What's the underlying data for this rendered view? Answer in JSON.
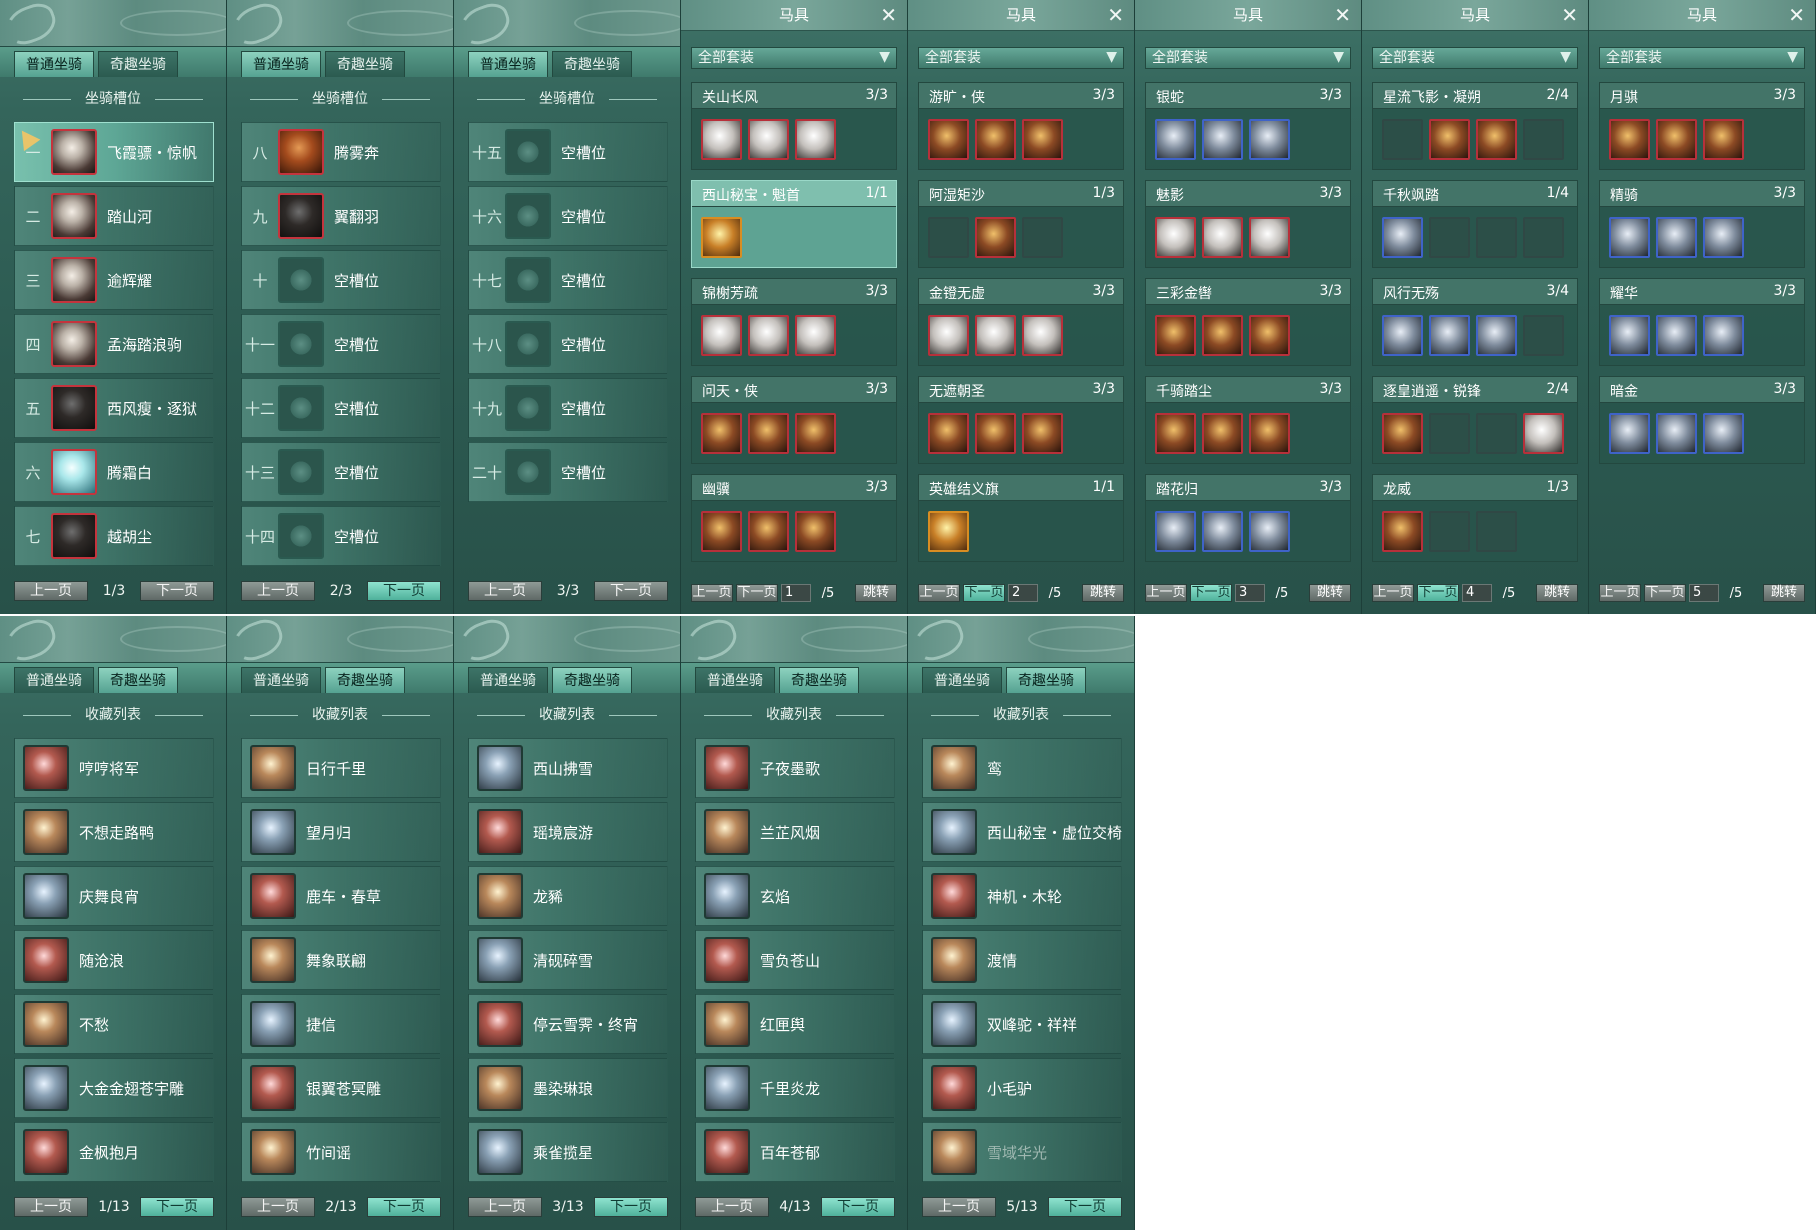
{
  "mount_tabs": {
    "normal": "普通坐骑",
    "fun": "奇趣坐骑"
  },
  "slot_section_title": "坐骑槽位",
  "collection_section_title": "收藏列表",
  "prev_label": "上一页",
  "next_label": "下一页",
  "empty_slot": "空槽位",
  "slot_pages": [
    {
      "page": "1/3",
      "rows": [
        {
          "num": "一",
          "name": "飞霞骠・惊帆"
        },
        {
          "num": "二",
          "name": "踏山河"
        },
        {
          "num": "三",
          "name": "逾辉耀"
        },
        {
          "num": "四",
          "name": "孟海踏浪驹"
        },
        {
          "num": "五",
          "name": "西风瘦・逐狱"
        },
        {
          "num": "六",
          "name": "腾霜白"
        },
        {
          "num": "七",
          "name": "越胡尘"
        }
      ]
    },
    {
      "page": "2/3",
      "rows": [
        {
          "num": "八",
          "name": "腾雾奔"
        },
        {
          "num": "九",
          "name": "翼翻羽"
        },
        {
          "num": "十",
          "name": "空槽位"
        },
        {
          "num": "十一",
          "name": "空槽位"
        },
        {
          "num": "十二",
          "name": "空槽位"
        },
        {
          "num": "十三",
          "name": "空槽位"
        },
        {
          "num": "十四",
          "name": "空槽位"
        }
      ]
    },
    {
      "page": "3/3",
      "rows": [
        {
          "num": "十五",
          "name": "空槽位"
        },
        {
          "num": "十六",
          "name": "空槽位"
        },
        {
          "num": "十七",
          "name": "空槽位"
        },
        {
          "num": "十八",
          "name": "空槽位"
        },
        {
          "num": "十九",
          "name": "空槽位"
        },
        {
          "num": "二十",
          "name": "空槽位"
        }
      ]
    }
  ],
  "collection_pages": [
    {
      "page": "1/13",
      "rows": [
        "哼哼将军",
        "不想走路鸭",
        "庆舞良宵",
        "随沧浪",
        "不愁",
        "大金金翅苍宇雕",
        "金枫抱月"
      ]
    },
    {
      "page": "2/13",
      "rows": [
        "日行千里",
        "望月归",
        "鹿车・春草",
        "舞象联翩",
        "捷信",
        "银翼苍冥雕",
        "竹间谣"
      ]
    },
    {
      "page": "3/13",
      "rows": [
        "西山拂雪",
        "瑶境宸游",
        "龙豨",
        "清砚碎雪",
        "停云雪霁・终宵",
        "墨染琳琅",
        "乘雀揽星"
      ]
    },
    {
      "page": "4/13",
      "rows": [
        "子夜墨歌",
        "兰芷风烟",
        "玄焰",
        "雪负苍山",
        "红匣舆",
        "千里炎龙",
        "百年苍郁"
      ]
    },
    {
      "page": "5/13",
      "rows": [
        "鸾",
        "西山秘宝・虚位交椅",
        "神机・木轮",
        "渡情",
        "双峰驼・祥祥",
        "小毛驴",
        "雪域华光"
      ]
    }
  ],
  "equip_title": "马具",
  "equip_filter": "全部套装",
  "equip_jump": "跳转",
  "equip_total": "/5",
  "equip_pages": [
    {
      "page_input": "1",
      "sets": [
        {
          "name": "关山长风",
          "count": "3/3",
          "slots": [
            "p",
            "p",
            "p"
          ]
        },
        {
          "name": "西山秘宝・魁首",
          "count": "1/1",
          "slots": [
            "o"
          ]
        },
        {
          "name": "锦榭芳疏",
          "count": "3/3",
          "slots": [
            "p",
            "p",
            "p"
          ]
        },
        {
          "name": "问天・侠",
          "count": "3/3",
          "slots": [
            "r",
            "r",
            "r"
          ]
        },
        {
          "name": "幽骥",
          "count": "3/3",
          "slots": [
            "r",
            "r",
            "r"
          ]
        }
      ]
    },
    {
      "page_input": "2",
      "sets": [
        {
          "name": "游旷・侠",
          "count": "3/3",
          "slots": [
            "r",
            "r",
            "r"
          ]
        },
        {
          "name": "阿湿矩沙",
          "count": "1/3",
          "slots": [
            "e",
            "r",
            "e"
          ]
        },
        {
          "name": "金镫无虚",
          "count": "3/3",
          "slots": [
            "p",
            "p",
            "p"
          ]
        },
        {
          "name": "无遮朝圣",
          "count": "3/3",
          "slots": [
            "r",
            "r",
            "r"
          ]
        },
        {
          "name": "英雄结义旗",
          "count": "1/1",
          "slots": [
            "o"
          ]
        }
      ]
    },
    {
      "page_input": "3",
      "sets": [
        {
          "name": "银蛇",
          "count": "3/3",
          "slots": [
            "b",
            "b",
            "b"
          ]
        },
        {
          "name": "魅影",
          "count": "3/3",
          "slots": [
            "p",
            "p",
            "p"
          ]
        },
        {
          "name": "三彩金辔",
          "count": "3/3",
          "slots": [
            "r",
            "r",
            "r"
          ]
        },
        {
          "name": "千骑踏尘",
          "count": "3/3",
          "slots": [
            "r",
            "r",
            "r"
          ]
        },
        {
          "name": "踏花归",
          "count": "3/3",
          "slots": [
            "b",
            "b",
            "b"
          ]
        }
      ]
    },
    {
      "page_input": "4",
      "sets": [
        {
          "name": "星流飞影・凝朔",
          "count": "2/4",
          "slots": [
            "e",
            "r",
            "r",
            "e"
          ]
        },
        {
          "name": "千秋飒踏",
          "count": "1/4",
          "slots": [
            "b",
            "e",
            "e",
            "e"
          ]
        },
        {
          "name": "风行无殇",
          "count": "3/4",
          "slots": [
            "b",
            "b",
            "b",
            "e"
          ]
        },
        {
          "name": "逐皇逍遥・锐锋",
          "count": "2/4",
          "slots": [
            "r",
            "e",
            "e",
            "p"
          ]
        },
        {
          "name": "龙威",
          "count": "1/3",
          "slots": [
            "r",
            "e",
            "e"
          ]
        }
      ]
    },
    {
      "page_input": "5",
      "sets": [
        {
          "name": "月骐",
          "count": "3/3",
          "slots": [
            "r",
            "r",
            "r"
          ]
        },
        {
          "name": "精骑",
          "count": "3/3",
          "slots": [
            "b",
            "b",
            "b"
          ]
        },
        {
          "name": "耀华",
          "count": "3/3",
          "slots": [
            "b",
            "b",
            "b"
          ]
        },
        {
          "name": "暗金",
          "count": "3/3",
          "slots": [
            "b",
            "b",
            "b"
          ]
        }
      ]
    }
  ]
}
